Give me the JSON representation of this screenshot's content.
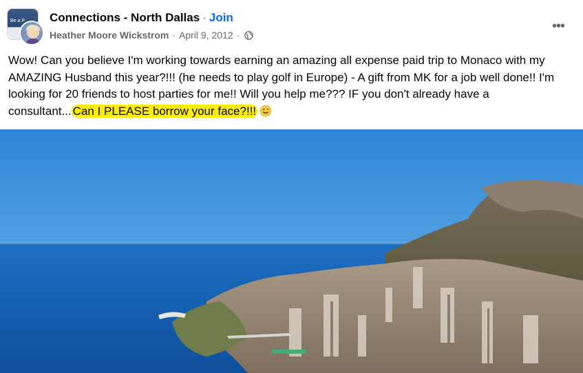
{
  "post": {
    "group_name": "Connections - North Dallas",
    "join_label": "Join",
    "author": "Heather Moore Wickstrom",
    "date": "April 9, 2012",
    "more_label": "•••",
    "group_avatar_text": "Be a P",
    "text_before_highlight": "Wow! Can you believe I'm working towards earning an amazing all expense paid trip to Monaco with my AMAZING Husband this year?!!! (he needs to play golf in Europe) - A gift from MK for a job well done!! I'm looking for 20 friends to host parties for me!! Will you help me??? IF you don't already have a consultant...",
    "highlighted_text": "Can I PLEASE borrow your face?!!!",
    "emoji": "smile-emoji-icon",
    "highlight_color": "#ffee00",
    "link_color": "#0866ff",
    "meta_color": "#65676b"
  },
  "photo": {
    "subject": "monaco-coastline-photo"
  }
}
